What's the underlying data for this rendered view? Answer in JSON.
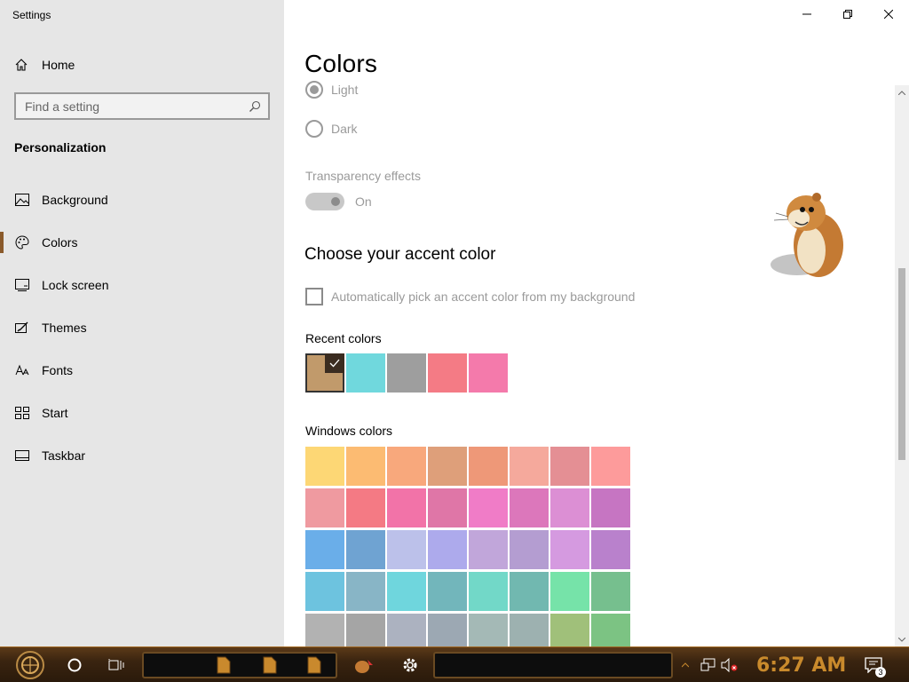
{
  "app": {
    "title": "Settings"
  },
  "sidebar": {
    "home_label": "Home",
    "search_placeholder": "Find a setting",
    "section_title": "Personalization",
    "items": [
      {
        "label": "Background",
        "icon": "picture-icon"
      },
      {
        "label": "Colors",
        "icon": "palette-icon",
        "active": true
      },
      {
        "label": "Lock screen",
        "icon": "lock-screen-icon"
      },
      {
        "label": "Themes",
        "icon": "themes-icon"
      },
      {
        "label": "Fonts",
        "icon": "fonts-icon"
      },
      {
        "label": "Start",
        "icon": "start-icon"
      },
      {
        "label": "Taskbar",
        "icon": "taskbar-icon"
      }
    ]
  },
  "main": {
    "title": "Colors",
    "mode_options": [
      {
        "label": "Light",
        "selected": true
      },
      {
        "label": "Dark",
        "selected": false
      }
    ],
    "transparency": {
      "label": "Transparency effects",
      "state": "On",
      "enabled": true
    },
    "accent_heading": "Choose your accent color",
    "auto_pick_label": "Automatically pick an accent color from my background",
    "auto_pick_checked": false,
    "recent_label": "Recent colors",
    "recent_colors": [
      "#c19a6b",
      "#70d8dd",
      "#9e9e9e",
      "#f47b85",
      "#f47aab"
    ],
    "windows_label": "Windows colors",
    "windows_colors": [
      [
        "#fdd775",
        "#fcbb72",
        "#f8a87c",
        "#de9f7a",
        "#ee9878",
        "#f5a99c",
        "#e48f94",
        "#fd9b9b"
      ],
      [
        "#ef9aa0",
        "#f47a84",
        "#f273a8",
        "#df76a7",
        "#f07cc7",
        "#dc77bb",
        "#dc8fd4",
        "#c675c2"
      ],
      [
        "#6aaee9",
        "#6fa3d2",
        "#bcc1ea",
        "#adaaec",
        "#c1a6da",
        "#b49dd1",
        "#d59ae0",
        "#b981cc"
      ],
      [
        "#6dc3df",
        "#88b5c6",
        "#6fd6dd",
        "#72b6bb",
        "#72d8c8",
        "#71b8b0",
        "#76e3a9",
        "#76bf8e"
      ],
      [
        "#b2b2b2",
        "#a5a5a5",
        "#acb2c0",
        "#9ca8b3",
        "#a4b9b6",
        "#9db1b0",
        "#a0c07a",
        "#7cc383"
      ]
    ]
  },
  "window_controls": {
    "minimize": "minimize-icon",
    "restore": "restore-icon",
    "close": "close-icon"
  },
  "taskbar": {
    "clock": "6:27 AM",
    "notification_count": "3"
  }
}
